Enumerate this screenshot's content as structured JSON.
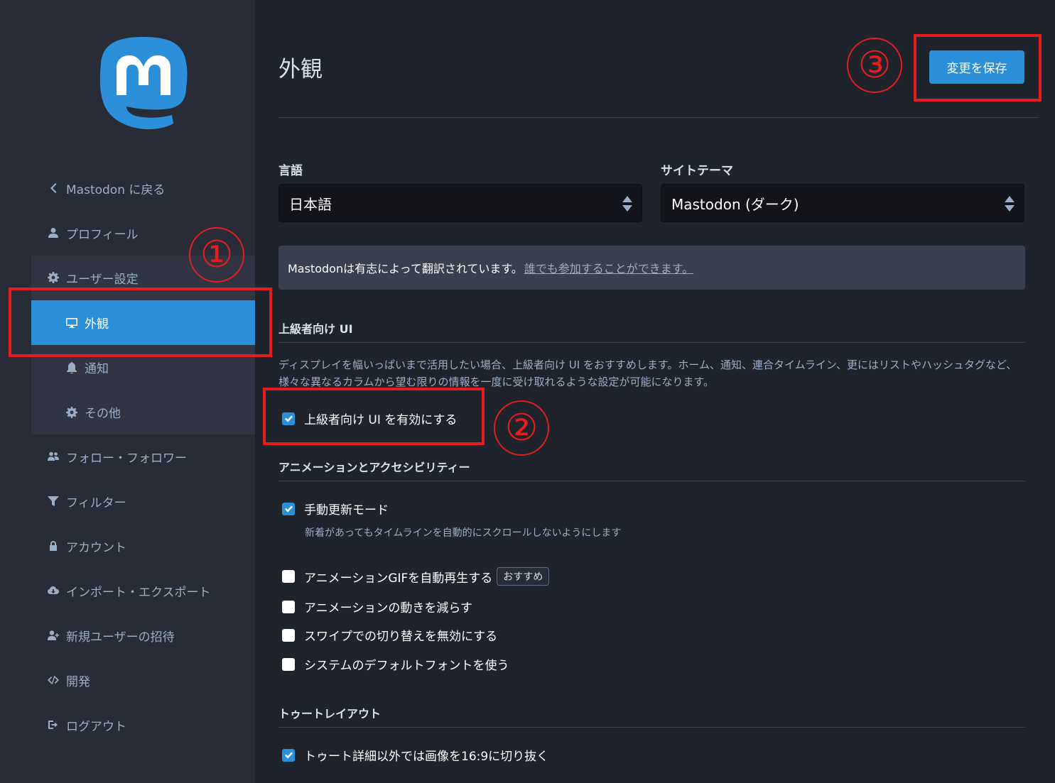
{
  "sidebar": {
    "back_label": "Mastodon に戻る",
    "items": [
      {
        "label": "プロフィール",
        "icon": "user-icon"
      },
      {
        "label": "ユーザー設定",
        "icon": "gear-icon"
      },
      {
        "label": "フォロー・フォロワー",
        "icon": "users-icon"
      },
      {
        "label": "フィルター",
        "icon": "filter-icon"
      },
      {
        "label": "アカウント",
        "icon": "lock-icon"
      },
      {
        "label": "インポート・エクスポート",
        "icon": "cloud-download-icon"
      },
      {
        "label": "新規ユーザーの招待",
        "icon": "user-plus-icon"
      },
      {
        "label": "開発",
        "icon": "code-icon"
      },
      {
        "label": "ログアウト",
        "icon": "sign-out-icon"
      }
    ],
    "sub_items": [
      {
        "label": "外観",
        "icon": "desktop-icon",
        "active": true
      },
      {
        "label": "通知",
        "icon": "bell-icon"
      },
      {
        "label": "その他",
        "icon": "gear-icon"
      }
    ]
  },
  "header": {
    "title": "外観",
    "save_label": "変更を保存"
  },
  "form": {
    "language": {
      "label": "言語",
      "value": "日本語"
    },
    "theme": {
      "label": "サイトテーマ",
      "value": "Mastodon (ダーク)"
    },
    "notice": {
      "text": "Mastodonは有志によって翻訳されています。",
      "link": "誰でも参加することができます。"
    },
    "advanced": {
      "title": "上級者向け UI",
      "description": "ディスプレイを幅いっぱいまで活用したい場合、上級者向け UI をおすすめします。ホーム、通知、連合タイムライン、更にはリストやハッシュタグなど、様々な異なるカラムから望む限りの情報を一度に受け取れるような設定が可能になります。",
      "checkbox": "上級者向け UI を有効にする"
    },
    "animation": {
      "title": "アニメーションとアクセシビリティー",
      "manual_label": "手動更新モード",
      "manual_hint": "新着があってもタイムラインを自動的にスクロールしないようにします",
      "gif_label": "アニメーションGIFを自動再生する",
      "gif_badge": "おすすめ",
      "reduce_label": "アニメーションの動きを減らす",
      "swipe_label": "スワイプでの切り替えを無効にする",
      "font_label": "システムのデフォルトフォントを使う"
    },
    "toot_layout": {
      "title": "トゥートレイアウト",
      "crop_label": "トゥート詳細以外では画像を16:9に切り抜く"
    }
  },
  "annotations": {
    "circle1": "①",
    "circle2": "②",
    "circle3": "③"
  },
  "colors": {
    "accent": "#2b90d9",
    "sidebar_bg": "#282c37",
    "main_bg": "#1f232b",
    "annotation_red": "#e41e1e"
  }
}
